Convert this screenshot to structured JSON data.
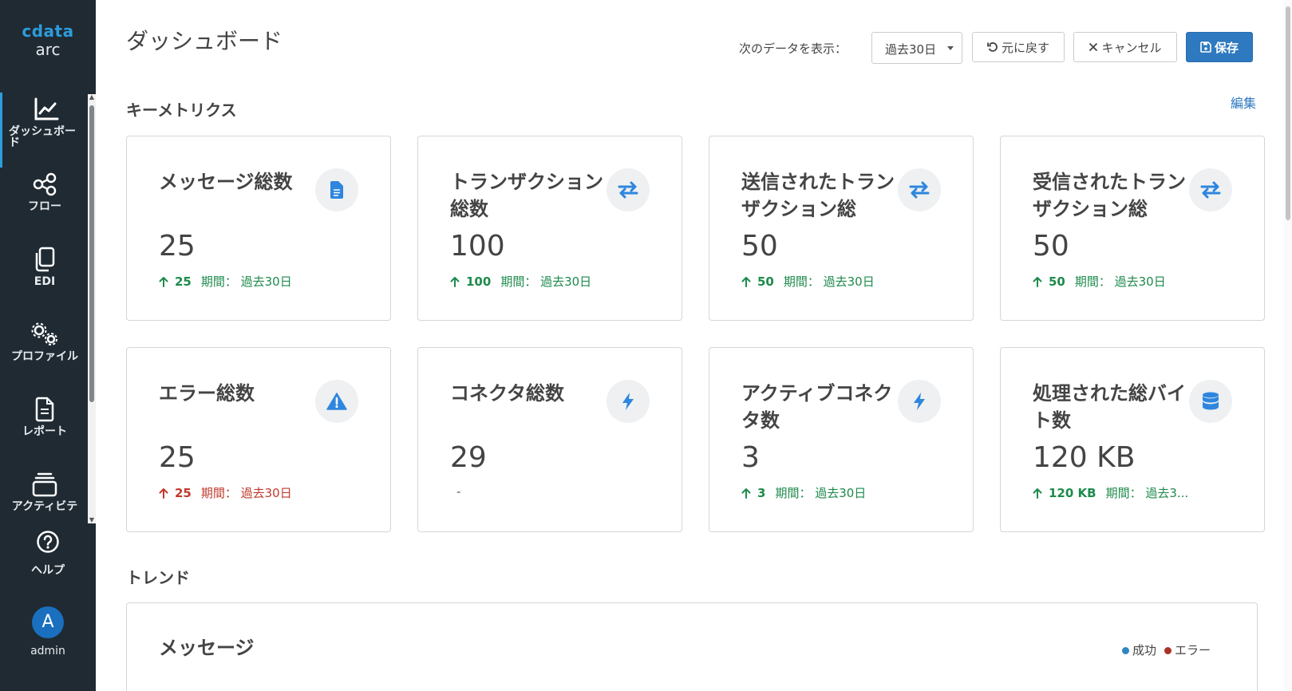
{
  "sidebar": {
    "logo_brand": "cdata",
    "logo_sub": "arc",
    "items": [
      {
        "label": "ダッシュボード",
        "icon": "chart-line-icon"
      },
      {
        "label": "フロー",
        "icon": "share-nodes-icon"
      },
      {
        "label": "EDI",
        "icon": "copy-icon"
      },
      {
        "label": "プロファイル",
        "icon": "gears-icon"
      },
      {
        "label": "レポート",
        "icon": "document-icon"
      },
      {
        "label": "アクティビテ",
        "icon": "layers-icon"
      }
    ],
    "help_label": "ヘルプ",
    "user_initial": "A",
    "user_name": "admin"
  },
  "header": {
    "title": "ダッシュボード",
    "show_label": "次のデータを表示：",
    "period_value": "過去30日",
    "revert_label": "元に戻す",
    "cancel_label": "キャンセル",
    "save_label": "保存"
  },
  "metrics": {
    "section_title": "キーメトリクス",
    "edit_label": "編集",
    "cards": [
      {
        "title": "メッセージ総数",
        "icon": "file-icon",
        "value": "25",
        "delta": "25",
        "period": "期間： 過去30日",
        "status": "up"
      },
      {
        "title": "トランザクション総数",
        "icon": "arrows-exchange-icon",
        "value": "100",
        "delta": "100",
        "period": "期間： 過去30日",
        "status": "up"
      },
      {
        "title": "送信されたトランザクション総",
        "icon": "arrows-exchange-icon",
        "value": "50",
        "delta": "50",
        "period": "期間： 過去30日",
        "status": "up"
      },
      {
        "title": "受信されたトランザクション総",
        "icon": "arrows-exchange-icon",
        "value": "50",
        "delta": "50",
        "period": "期間： 過去30日",
        "status": "up"
      },
      {
        "title": "エラー総数",
        "icon": "warning-triangle-icon",
        "value": "25",
        "delta": "25",
        "period": "期間： 過去30日",
        "status": "error"
      },
      {
        "title": "コネクタ総数",
        "icon": "bolt-icon",
        "value": "29",
        "delta": "-",
        "period": "",
        "status": "none"
      },
      {
        "title": "アクティブコネクタ数",
        "icon": "bolt-icon",
        "value": "3",
        "delta": "3",
        "period": "期間： 過去30日",
        "status": "up"
      },
      {
        "title": "処理された総バイト数",
        "icon": "database-icon",
        "value": "120 KB",
        "delta": "120 KB",
        "period": "期間： 過去3...",
        "status": "up"
      }
    ]
  },
  "trends": {
    "section_title": "トレンド",
    "card_title": "メッセージ",
    "legend": [
      {
        "label": "成功",
        "color": "#2e86c1"
      },
      {
        "label": "エラー",
        "color": "#a93226"
      }
    ]
  },
  "colors": {
    "sidebar_bg": "#1f2a33",
    "accent": "#2e79bf",
    "success": "#1e8a4c",
    "error": "#c0392b"
  }
}
